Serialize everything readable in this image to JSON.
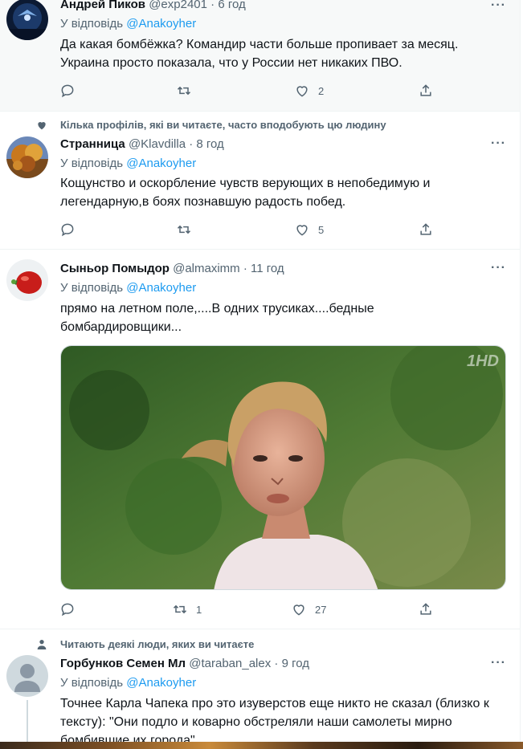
{
  "tweets": [
    {
      "name": "Андрей Пиков",
      "handle": "@exp2401",
      "time": "6 год",
      "reply_prefix": "У відповідь",
      "reply_to": "@Anakoyher",
      "text": "Да какая бомбёжка? Командир части больше пропивает за месяц. Украина просто показала, что у России нет никаких ПВО.",
      "likes": "2"
    },
    {
      "social_context": "Кілька профілів, які ви читаєте, часто вподобують цю людину",
      "name": "Странница",
      "handle": "@Klavdilla",
      "time": "8 год",
      "reply_prefix": "У відповідь",
      "reply_to": "@Anakoyher",
      "text": "Кощунство и оскорбление чувств верующих в непобедимую и легендарную,в боях познавшую радость побед.",
      "likes": "5"
    },
    {
      "name": "Сыньор Помыдор",
      "handle": "@almaximm",
      "time": "11 год",
      "reply_prefix": "У відповідь",
      "reply_to": "@Anakoyher",
      "text": "прямо на летном поле,....В одних трусиках....бедные бомбардировщики...",
      "retweets": "1",
      "likes": "27",
      "media_watermark": "1HD"
    },
    {
      "social_context": "Читають деякі люди, яких ви читаєте",
      "name": "Горбунков Семен Мл",
      "handle": "@taraban_alex",
      "time": "9 год",
      "reply_prefix": "У відповідь",
      "reply_to": "@Anakoyher",
      "text": "Точнее Карла Чапека про это изуверстов еще никто не сказал (близко к тексту): \"Они подло и коварно обстреляли наши самолеты мирно бомбившие их города\""
    }
  ],
  "more_glyph": "···",
  "separator": "·",
  "colors": {
    "accent": "#1d9bf0",
    "muted": "#536471",
    "text": "#0f1419",
    "border": "#eff3f4"
  }
}
